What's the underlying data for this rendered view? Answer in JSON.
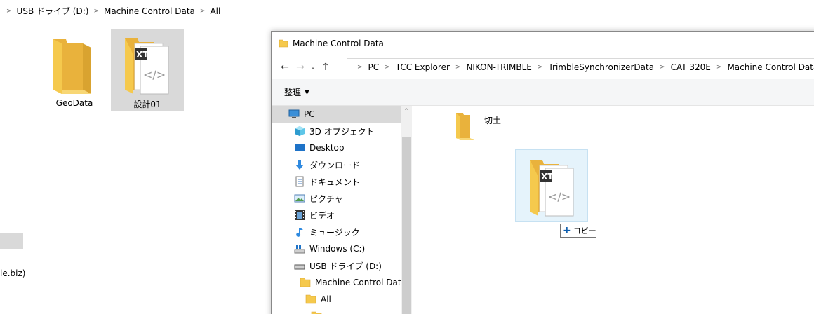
{
  "background": {
    "breadcrumb": [
      "USB ドライブ (D:)",
      "Machine Control Data",
      "All"
    ],
    "items": [
      {
        "label": "GeoData",
        "selected": false
      },
      {
        "label": "設計01",
        "selected": true
      }
    ],
    "left_text": "le.biz)"
  },
  "dialog": {
    "title": "Machine Control Data",
    "address": [
      "PC",
      "TCC Explorer",
      "NIKON-TRIMBLE",
      "TrimbleSynchronizerData",
      "CAT 320E",
      "Machine Control Data"
    ],
    "toolbar": {
      "organize": "整理"
    },
    "nav": [
      {
        "label": "PC",
        "icon": "pc-icon",
        "selected": true
      },
      {
        "label": "3D オブジェクト",
        "icon": "3d-objects-icon"
      },
      {
        "label": "Desktop",
        "icon": "desktop-icon"
      },
      {
        "label": "ダウンロード",
        "icon": "download-icon"
      },
      {
        "label": "ドキュメント",
        "icon": "document-icon"
      },
      {
        "label": "ピクチャ",
        "icon": "pictures-icon"
      },
      {
        "label": "ビデオ",
        "icon": "video-icon"
      },
      {
        "label": "ミュージック",
        "icon": "music-icon"
      },
      {
        "label": "Windows (C:)",
        "icon": "drive-c-icon"
      },
      {
        "label": "USB ドライブ (D:)",
        "icon": "usb-drive-icon"
      },
      {
        "label": "Machine Control Data",
        "icon": "folder-icon"
      },
      {
        "label": "All",
        "icon": "folder-icon"
      }
    ],
    "content": {
      "folder_label": "切土",
      "copy_tooltip": "コピー"
    }
  },
  "colors": {
    "folder": "#f5c94d",
    "selection": "#d9d9d9",
    "drag_highlight": "#e5f3fb",
    "accent": "#0b5cad"
  }
}
